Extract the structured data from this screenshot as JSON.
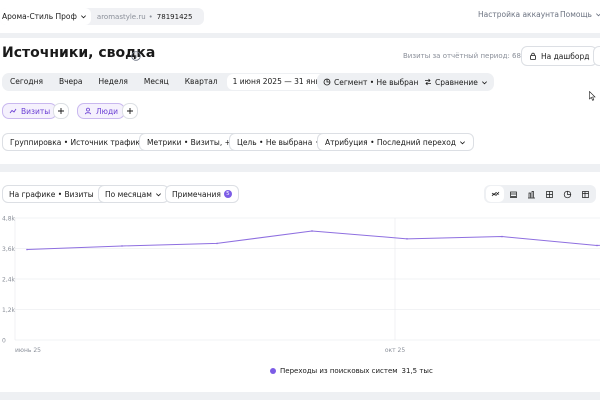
{
  "topbar": {
    "account_name": "Арома-Стиль Проф",
    "site_url": "aromastyle.ru",
    "separator": "•",
    "counter_id": "78191425",
    "account_settings": "Настройка аккаунта",
    "help": "Помощь"
  },
  "header": {
    "title": "Источники, сводка",
    "visits_summary": "Визиты за отчётный период: 68 603",
    "dashboard_button": "На дашборд"
  },
  "period": {
    "items": [
      "Сегодня",
      "Вчера",
      "Неделя",
      "Месяц",
      "Квартал"
    ],
    "date_range": "1 июня 2025 — 31 янв 2026",
    "segment": "Сегмент • Не выбран",
    "compare": "Сравнение"
  },
  "tags": {
    "visits": "Визиты",
    "people": "Люди"
  },
  "filters": {
    "grouping": "Группировка • Источник трафика, +1",
    "metrics": "Метрики • Визиты, +4",
    "goal": "Цель • Не выбрана",
    "attribution": "Атрибуция • Последний переход"
  },
  "chart_controls": {
    "on_chart": "На графике • Визиты",
    "by_period": "По месяцам",
    "notes": "Примечания",
    "notes_count": "5",
    "chart_type_icons": [
      "line-chart-icon",
      "stacked-area-icon",
      "bar-chart-icon",
      "stacked-bar-icon",
      "pie-chart-icon",
      "table-chart-icon"
    ]
  },
  "colors": {
    "accent": "#7c5ce6",
    "series_line": "#8e6fe0",
    "grid": "#e6e8ec"
  },
  "chart_data": {
    "type": "line",
    "x": [
      "июн 25",
      "июл 25",
      "авг 25",
      "сен 25",
      "окт 25",
      "ноя 25",
      "дек 25",
      "янв 26"
    ],
    "x_tick_labels": [
      "июнь 25",
      "окт 25"
    ],
    "y_tick_labels": [
      "4,8k",
      "3,6k",
      "2,4k",
      "1,2k",
      "0"
    ],
    "ylim": [
      0,
      4800
    ],
    "grid": true,
    "legend_position": "bottom",
    "series": [
      {
        "name": "Переходы из поисковых систем",
        "total": "31,5 тыс",
        "values": [
          3560,
          3700,
          3800,
          4290,
          3980,
          4070,
          3720,
          3950
        ]
      }
    ]
  }
}
